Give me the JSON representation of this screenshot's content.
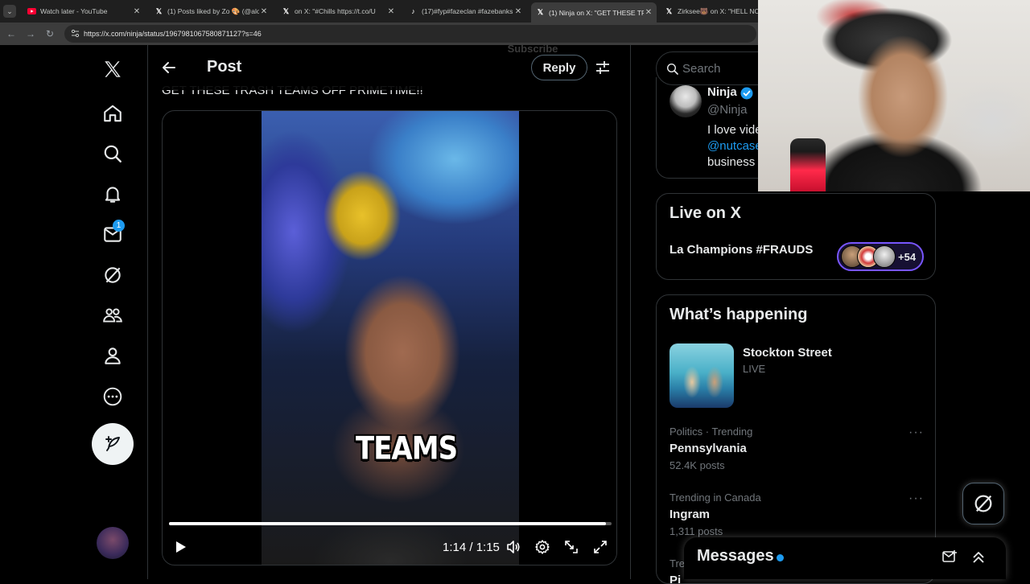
{
  "browser": {
    "tabs": [
      {
        "title": "Watch later - YouTube",
        "icon": "youtube-icon"
      },
      {
        "title": "(1) Posts liked by Zo 🎨 (@alon",
        "icon": "x-logo-icon"
      },
      {
        "title": "on X: \"#Chills https://t.co/U",
        "icon": "x-logo-icon"
      },
      {
        "title": "(17)#fyp#fazeclan #fazebanks #",
        "icon": "tiktok-icon"
      },
      {
        "title": "(1) Ninja on X: \"GET THESE TRA",
        "icon": "x-logo-icon",
        "active": true
      },
      {
        "title": "Zirksee🐻 on X: \"HELL NO h",
        "icon": "x-logo-icon"
      }
    ],
    "url": "https://x.com/ninja/status/1967981067580871127?s=46"
  },
  "nav": {
    "messages_badge": "1"
  },
  "header": {
    "title": "Post",
    "reply_label": "Reply",
    "ghost_subscribe": "Subscribe"
  },
  "post": {
    "text": "GET THESE TRASH TEAMS OFF PRIMETIME!!",
    "video": {
      "caption": "TEAMS",
      "time": "1:14 / 1:15",
      "progress": 0.987
    }
  },
  "search": {
    "placeholder": "Search"
  },
  "profile": {
    "name": "Ninja",
    "handle": "@Ninja",
    "bio_line1": "I love vide",
    "bio_mention": "@nutcase",
    "bio_line3": "business"
  },
  "live": {
    "title": "Live on X",
    "space_title": "La Champions #FRAUDS",
    "listener_count": "+54"
  },
  "happening": {
    "title": "What’s happening",
    "featured": {
      "title": "Stockton Street",
      "status": "LIVE"
    },
    "trends": [
      {
        "context": "Politics · Trending",
        "name": "Pennsylvania",
        "posts": "52.4K posts"
      },
      {
        "context": "Trending in Canada",
        "name": "Ingram",
        "posts": "1,311 posts"
      },
      {
        "context": "Tre",
        "name": "Pi",
        "posts": ""
      }
    ]
  },
  "messages": {
    "title": "Messages"
  },
  "colors": {
    "accent": "#1d9bf0",
    "background": "#000000",
    "border": "#2f3336",
    "muted_text": "#71767b",
    "live_pill": "#7856ff"
  }
}
